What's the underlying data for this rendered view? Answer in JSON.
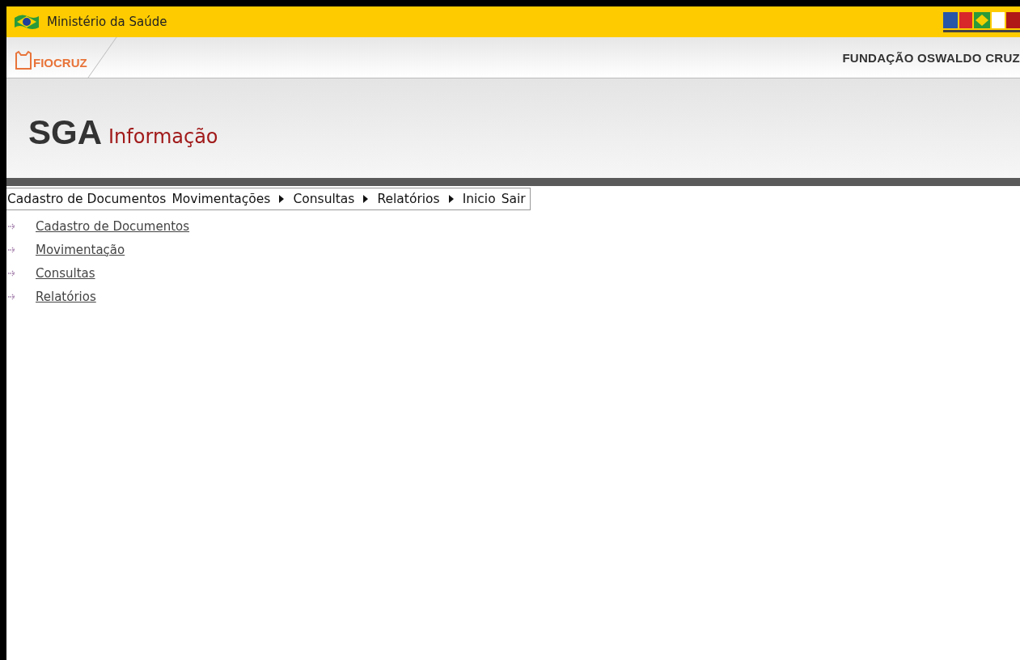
{
  "gov_bar": {
    "title": "Ministério da Saúde"
  },
  "institution_bar": {
    "logo_text": "FIOCRUZ",
    "name": "FUNDAÇÃO OSWALDO CRUZ"
  },
  "banner": {
    "title": "SGA",
    "subtitle": "Informação"
  },
  "menu": [
    {
      "label": "Cadastro de Documentos",
      "has_submenu": false
    },
    {
      "label": "Movimentações",
      "has_submenu": true
    },
    {
      "label": "Consultas",
      "has_submenu": true
    },
    {
      "label": "Relatórios",
      "has_submenu": true
    },
    {
      "label": "Inicio",
      "has_submenu": false
    },
    {
      "label": "Sair",
      "has_submenu": false
    }
  ],
  "links": [
    {
      "label": "Cadastro de Documentos"
    },
    {
      "label": "Movimentação"
    },
    {
      "label": "Consultas"
    },
    {
      "label": "Relatórios"
    }
  ]
}
